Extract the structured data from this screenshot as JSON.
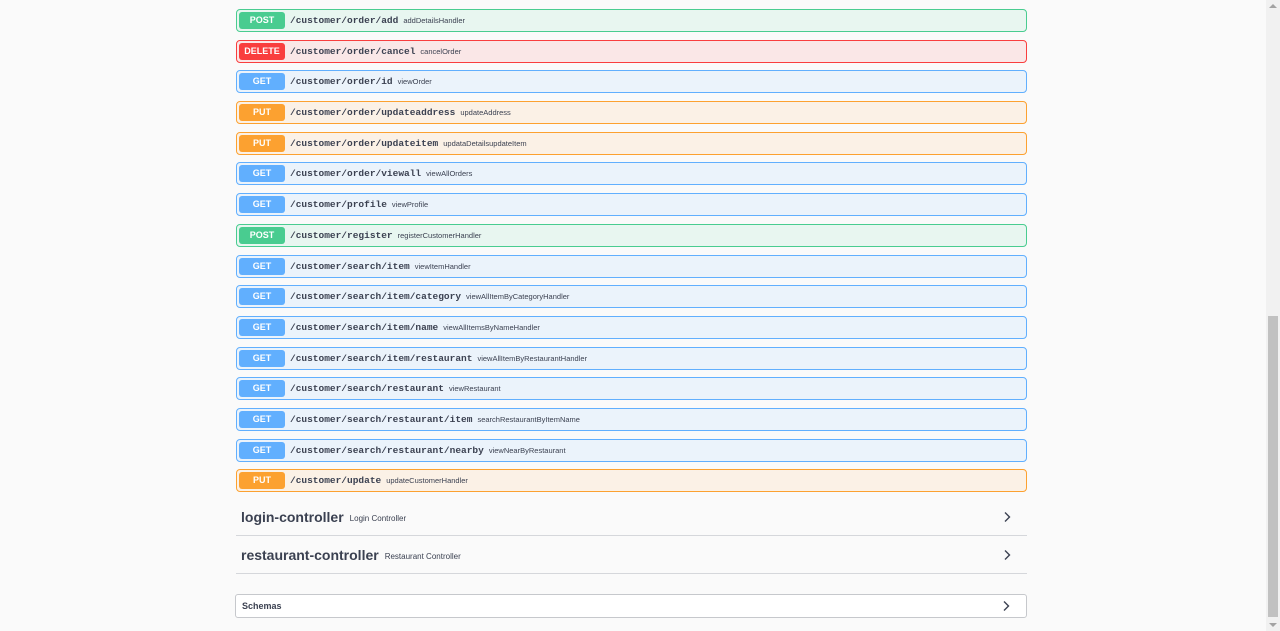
{
  "operations": [
    {
      "method": "POST",
      "path": "/customer/order/add",
      "summary": "addDetailsHandler"
    },
    {
      "method": "DELETE",
      "path": "/customer/order/cancel",
      "summary": "cancelOrder"
    },
    {
      "method": "GET",
      "path": "/customer/order/id",
      "summary": "viewOrder"
    },
    {
      "method": "PUT",
      "path": "/customer/order/updateaddress",
      "summary": "updateAddress"
    },
    {
      "method": "PUT",
      "path": "/customer/order/updateitem",
      "summary": "updataDetailsupdateItem"
    },
    {
      "method": "GET",
      "path": "/customer/order/viewall",
      "summary": "viewAllOrders"
    },
    {
      "method": "GET",
      "path": "/customer/profile",
      "summary": "viewProfile"
    },
    {
      "method": "POST",
      "path": "/customer/register",
      "summary": "registerCustomerHandler"
    },
    {
      "method": "GET",
      "path": "/customer/search/item",
      "summary": "viewItemHandler"
    },
    {
      "method": "GET",
      "path": "/customer/search/item/category",
      "summary": "viewAllItemByCategoryHandler"
    },
    {
      "method": "GET",
      "path": "/customer/search/item/name",
      "summary": "viewAllItemsByNameHandler"
    },
    {
      "method": "GET",
      "path": "/customer/search/item/restaurant",
      "summary": "viewAllItemByRestaurantHandler"
    },
    {
      "method": "GET",
      "path": "/customer/search/restaurant",
      "summary": "viewRestaurant"
    },
    {
      "method": "GET",
      "path": "/customer/search/restaurant/item",
      "summary": "searchRestaurantByItemName"
    },
    {
      "method": "GET",
      "path": "/customer/search/restaurant/nearby",
      "summary": "viewNearByRestaurant"
    },
    {
      "method": "PUT",
      "path": "/customer/update",
      "summary": "updateCustomerHandler"
    }
  ],
  "tags": [
    {
      "name": "login-controller",
      "description": "Login Controller"
    },
    {
      "name": "restaurant-controller",
      "description": "Restaurant Controller"
    }
  ],
  "schemas": {
    "title": "Schemas"
  },
  "colors": {
    "get": "#61affe",
    "post": "#49cc90",
    "put": "#fca130",
    "delete": "#f93e3e",
    "text": "#3b4151"
  },
  "icons": {
    "expand": "chevron-right-icon"
  }
}
